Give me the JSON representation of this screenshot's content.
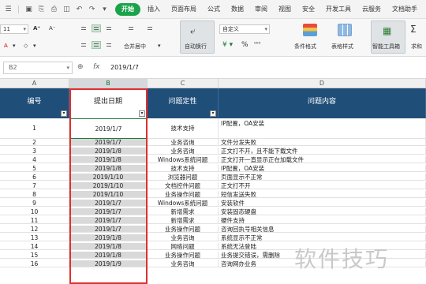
{
  "menubar": {
    "tabs": [
      "开始",
      "插入",
      "页面布局",
      "公式",
      "数据",
      "审阅",
      "视图",
      "安全",
      "开发工具",
      "云服务",
      "文档助手"
    ],
    "active_tab": "开始"
  },
  "ribbon": {
    "font_size": "11",
    "merge_center": "合并居中",
    "auto_wrap": "自动换行",
    "number_format": "自定义",
    "cond_format": "条件格式",
    "table_style": "表格样式",
    "smart_toolbox": "智能工具箱",
    "last": "求和"
  },
  "formula_bar": {
    "name_box": "B2",
    "fx": "fx",
    "value": "2019/1/7"
  },
  "columns": [
    "A",
    "B",
    "C",
    "D"
  ],
  "header": {
    "col_a": "编号",
    "col_b": "提出日期",
    "col_c": "问题定性",
    "col_d": "问题内容"
  },
  "rows": [
    {
      "n": "1",
      "date": "2019/1/7",
      "type": "技术支持",
      "content": "IP配置，OA安装"
    },
    {
      "n": "2",
      "date": "2019/1/7",
      "type": "业务咨询",
      "content": "文件分发失败"
    },
    {
      "n": "3",
      "date": "2019/1/8",
      "type": "业务咨询",
      "content": "正文打不开，且不能下载文件"
    },
    {
      "n": "4",
      "date": "2019/1/8",
      "type": "Windows系统问题",
      "content": "正文打开一直显示正在加载文件"
    },
    {
      "n": "5",
      "date": "2019/1/8",
      "type": "技术支持",
      "content": "IP配置，OA安装"
    },
    {
      "n": "6",
      "date": "2019/1/10",
      "type": "浏览器问题",
      "content": "页面显示不正常"
    },
    {
      "n": "7",
      "date": "2019/1/10",
      "type": "文档控件问题",
      "content": "正文打不开"
    },
    {
      "n": "8",
      "date": "2019/1/10",
      "type": "业务操作问题",
      "content": "短信发送失败"
    },
    {
      "n": "9",
      "date": "2019/1/7",
      "type": "Windows系统问题",
      "content": "安装软件"
    },
    {
      "n": "10",
      "date": "2019/1/7",
      "type": "新增需求",
      "content": "安装固态硬盘"
    },
    {
      "n": "11",
      "date": "2019/1/7",
      "type": "新增需求",
      "content": "硬件支持"
    },
    {
      "n": "12",
      "date": "2019/1/7",
      "type": "业务操作问题",
      "content": "咨询回执号相关信息"
    },
    {
      "n": "13",
      "date": "2019/1/8",
      "type": "业务咨询",
      "content": "系统显示不正常"
    },
    {
      "n": "14",
      "date": "2019/1/8",
      "type": "网络问题",
      "content": "系统无法登陆"
    },
    {
      "n": "15",
      "date": "2019/1/8",
      "type": "业务操作问题",
      "content": "业务提交错误，需删除"
    },
    {
      "n": "16",
      "date": "2019/1/9",
      "type": "业务咨询",
      "content": "咨询网办业务"
    }
  ],
  "watermark": "软件技巧"
}
